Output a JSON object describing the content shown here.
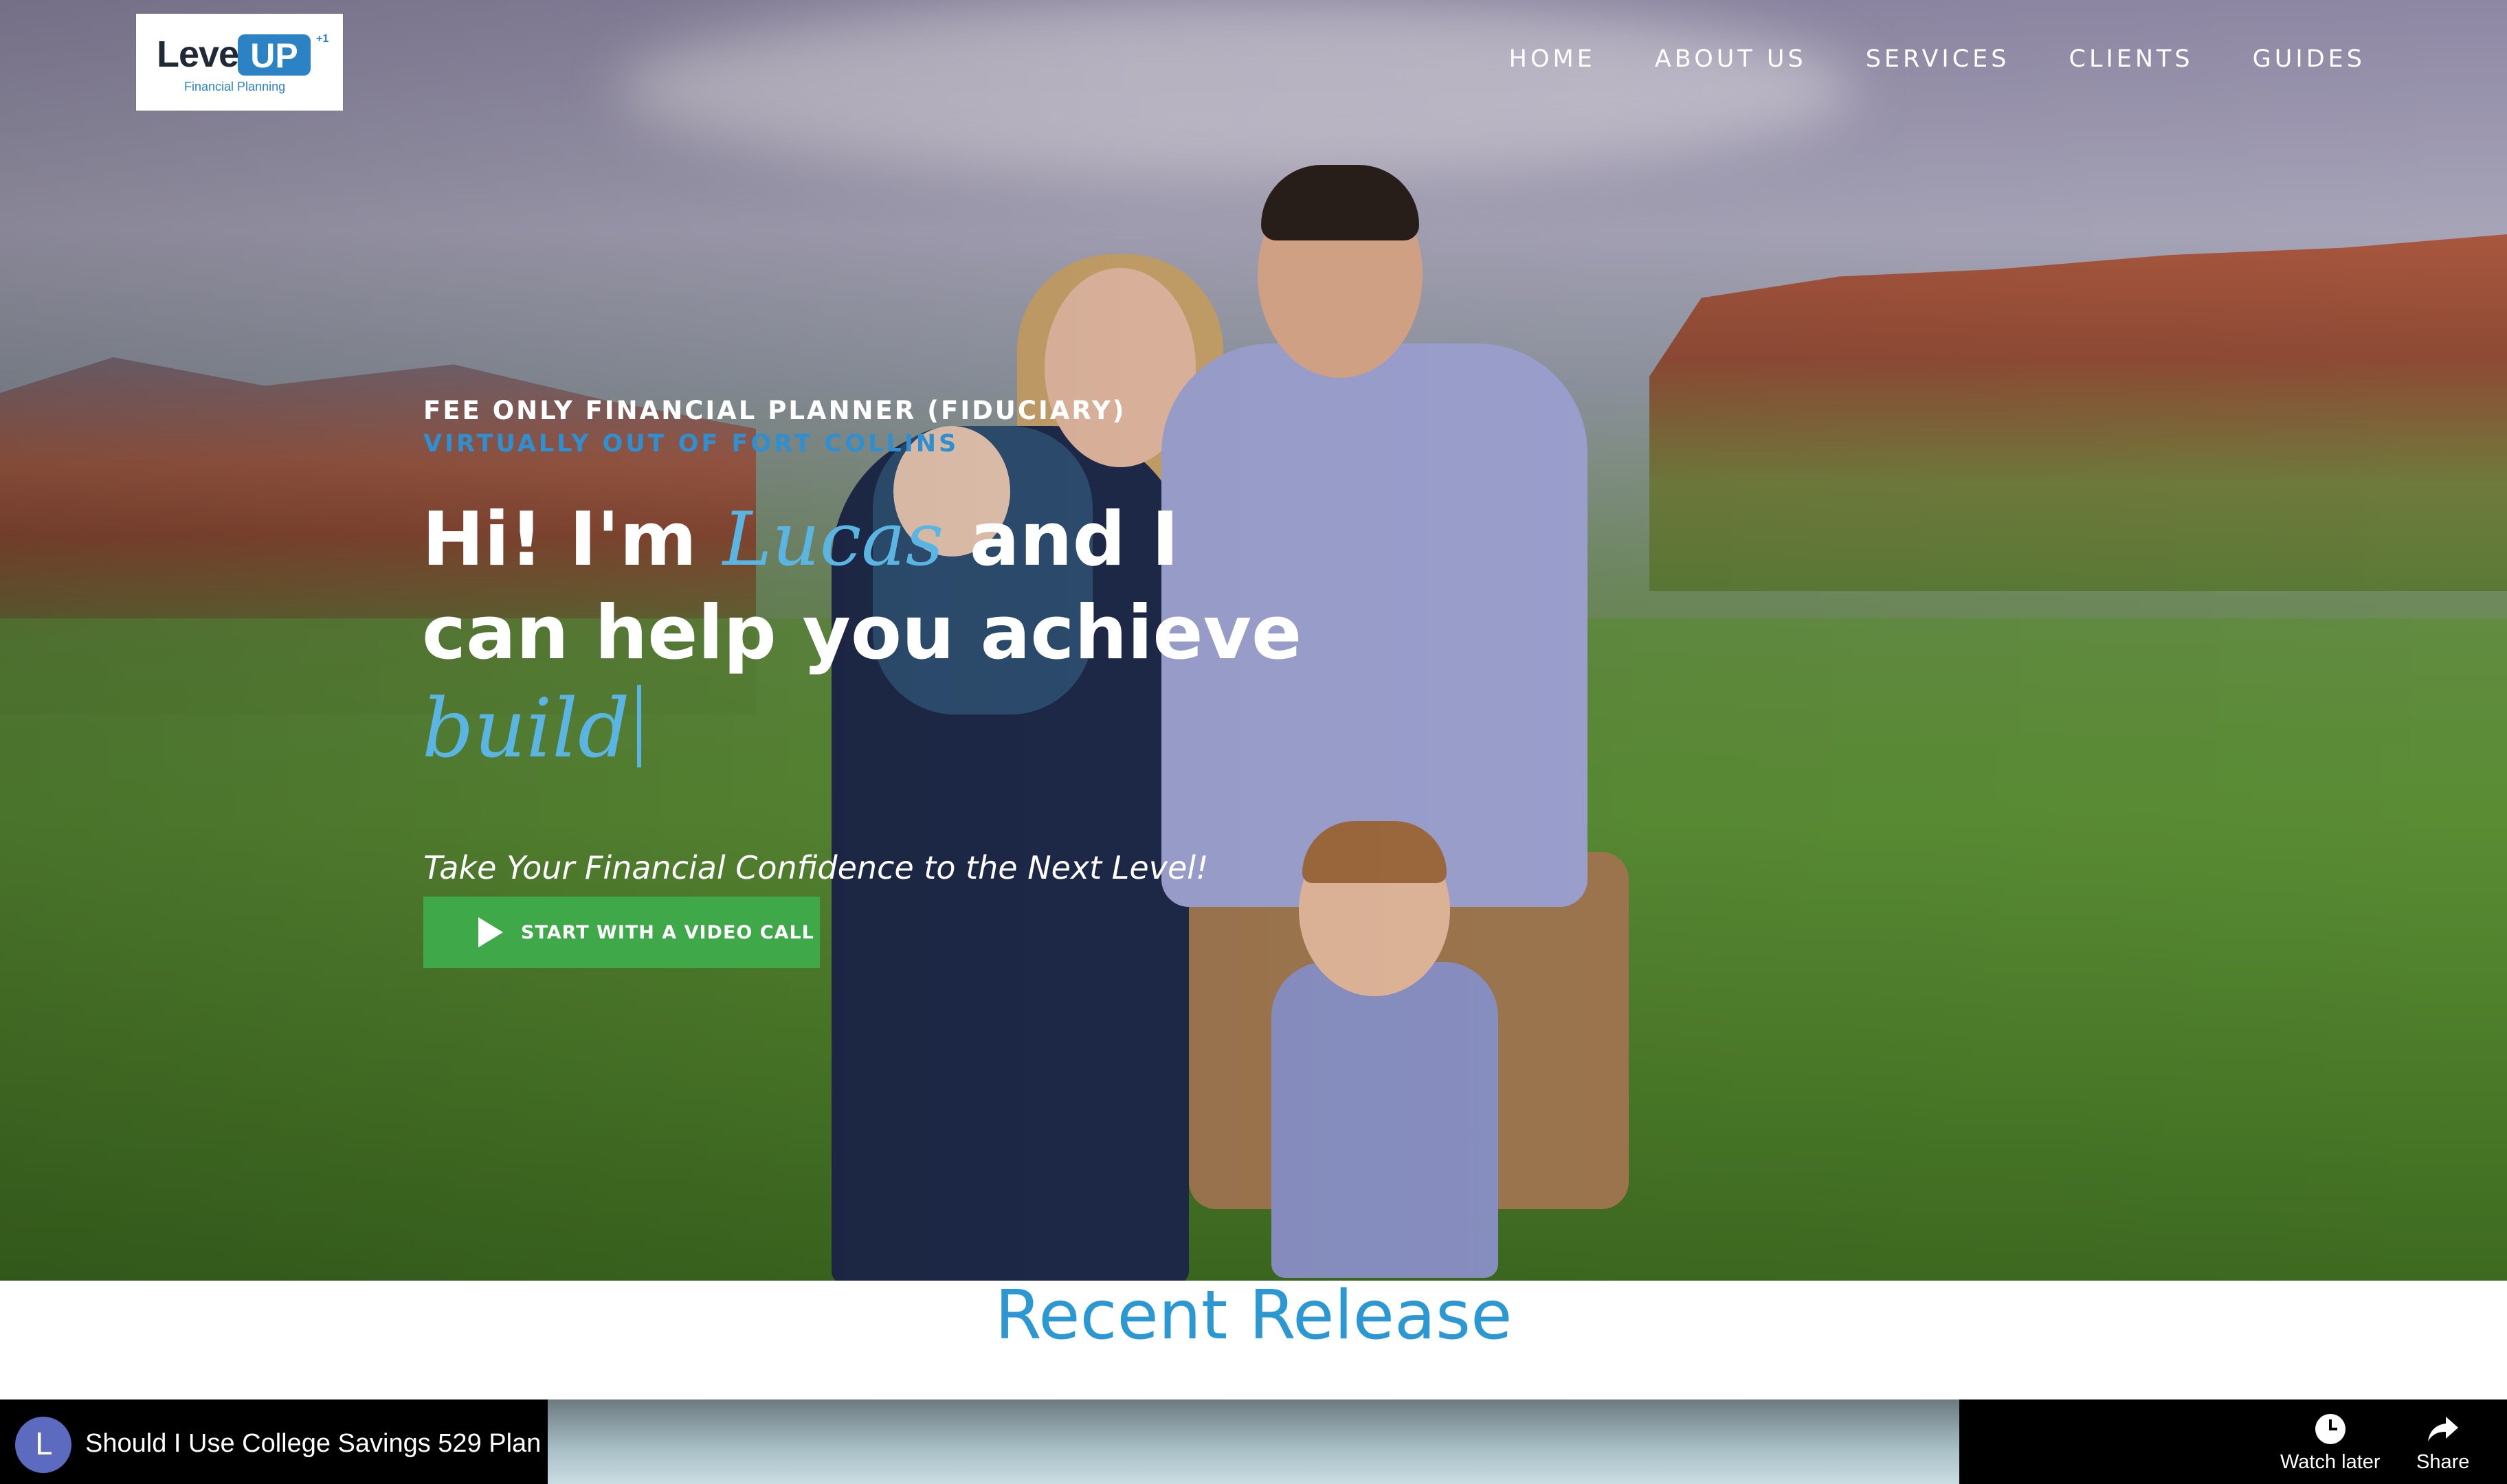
{
  "logo": {
    "word": "Level",
    "up": "UP",
    "sup": "+1",
    "sub": "Financial Planning"
  },
  "nav": {
    "items": [
      "HOME",
      "ABOUT US",
      "SERVICES",
      "CLIENTS",
      "GUIDES"
    ]
  },
  "hero": {
    "eyebrow": "FEE ONLY FINANCIAL PLANNER (FIDUCIARY)",
    "eyebrow_sub": "VIRTUALLY OUT OF FORT COLLINS",
    "headline_part1": "Hi! I'm ",
    "headline_name": "Lucas",
    "headline_part2": " and I can help you achieve",
    "typed_word": "build",
    "tagline": "Take Your Financial Confidence to the Next Level!",
    "cta_label": "START WITH A VIDEO CALL"
  },
  "section": {
    "title": "Recent Release"
  },
  "video": {
    "avatar_letter": "L",
    "title": "Should I Use College Savings 529 Plan",
    "watch_later": "Watch later",
    "share": "Share"
  },
  "colors": {
    "accent": "#2b97d3",
    "cta": "#3fa94a",
    "headline_accent": "#5bb5e2"
  }
}
